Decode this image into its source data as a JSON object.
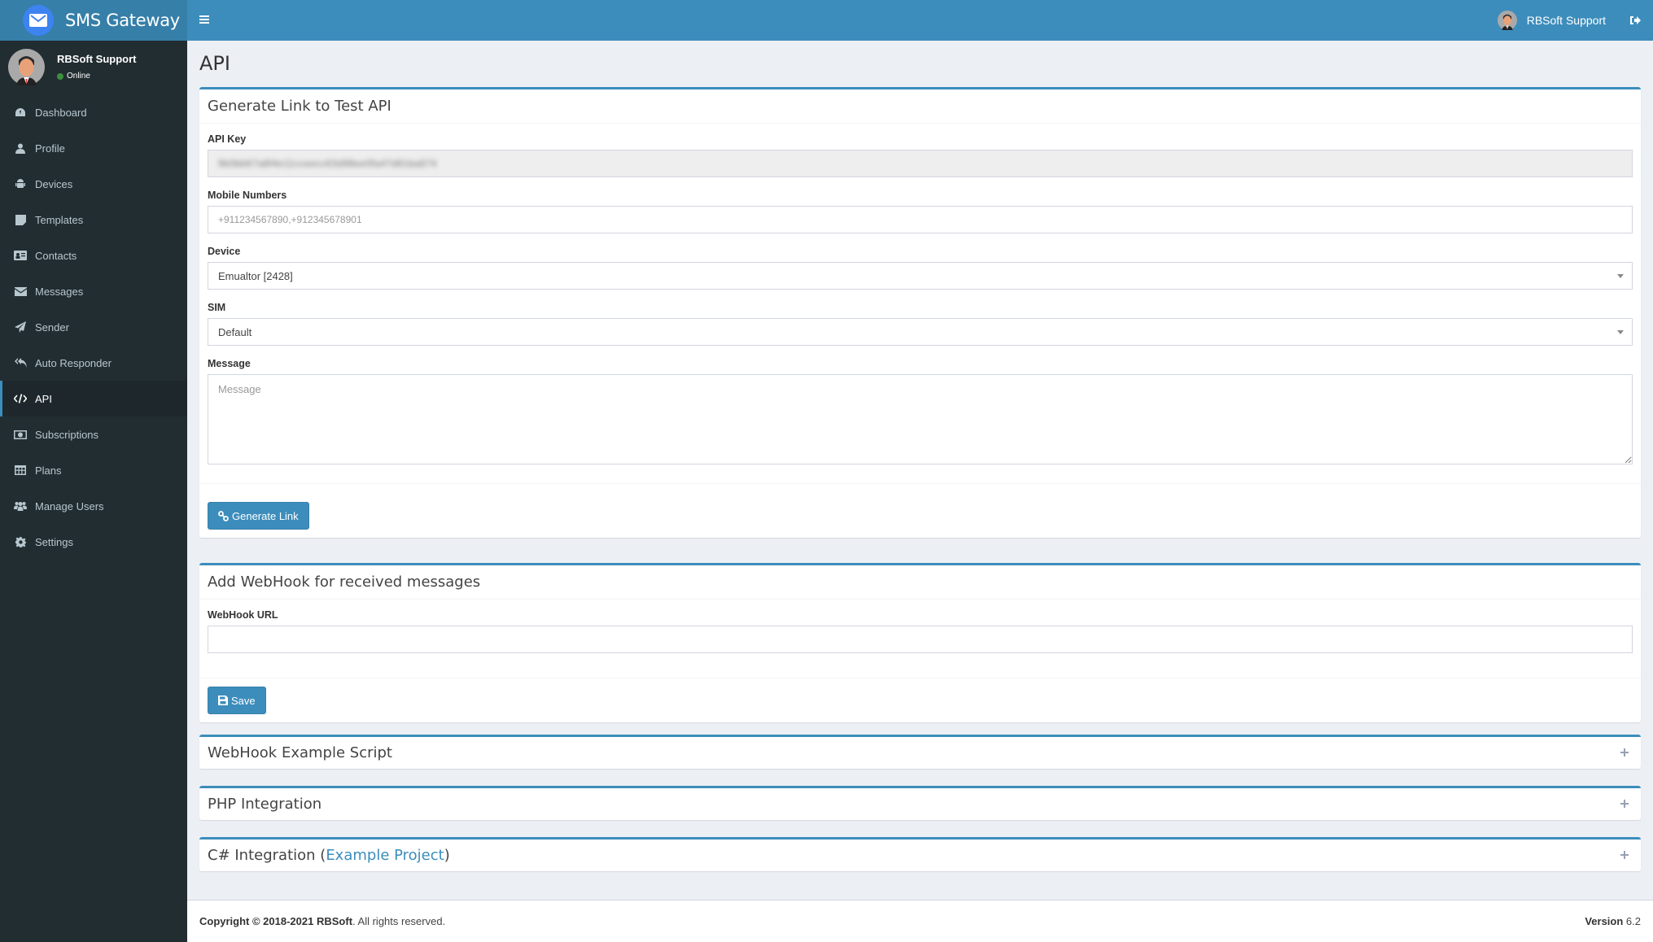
{
  "app": {
    "title": "SMS Gateway",
    "user_name": "RBSoft Support",
    "user_status": "Online"
  },
  "colors": {
    "primary": "#3c8dbc",
    "sidebar_bg": "#222d32",
    "online": "#3c8f3c"
  },
  "sidebar": {
    "items": [
      {
        "label": "Dashboard",
        "icon": "dashboard-icon"
      },
      {
        "label": "Profile",
        "icon": "user-icon"
      },
      {
        "label": "Devices",
        "icon": "android-icon"
      },
      {
        "label": "Templates",
        "icon": "sticky-note-icon"
      },
      {
        "label": "Contacts",
        "icon": "address-card-icon"
      },
      {
        "label": "Messages",
        "icon": "envelope-icon"
      },
      {
        "label": "Sender",
        "icon": "paper-plane-icon"
      },
      {
        "label": "Auto Responder",
        "icon": "reply-all-icon"
      },
      {
        "label": "API",
        "icon": "code-icon",
        "active": true
      },
      {
        "label": "Subscriptions",
        "icon": "money-icon"
      },
      {
        "label": "Plans",
        "icon": "table-icon"
      },
      {
        "label": "Manage Users",
        "icon": "users-icon"
      },
      {
        "label": "Settings",
        "icon": "gear-icon"
      }
    ]
  },
  "page": {
    "title": "API"
  },
  "generate_box": {
    "title": "Generate Link to Test API",
    "api_key_label": "API Key",
    "api_key_value": "9b0bb67a8f4e11cceecc63d98ee0fa47d81ba874",
    "mobile_label": "Mobile Numbers",
    "mobile_placeholder": "+911234567890,+912345678901",
    "device_label": "Device",
    "device_value": "Emualtor [2428]",
    "sim_label": "SIM",
    "sim_value": "Default",
    "message_label": "Message",
    "message_placeholder": "Message",
    "button_label": "Generate Link"
  },
  "webhook_box": {
    "title": "Add WebHook for received messages",
    "url_label": "WebHook URL",
    "url_value": "",
    "button_label": "Save"
  },
  "collapsed_boxes": {
    "webhook_script": "WebHook Example Script",
    "php": "PHP Integration",
    "csharp_prefix": "C# Integration (",
    "csharp_link": "Example Project",
    "csharp_suffix": ")"
  },
  "footer": {
    "copyright_prefix": "Copyright © 2018-2021",
    "company": "RBSoft",
    "rights": ". All rights reserved.",
    "version_label": "Version",
    "version_value": "6.2"
  }
}
